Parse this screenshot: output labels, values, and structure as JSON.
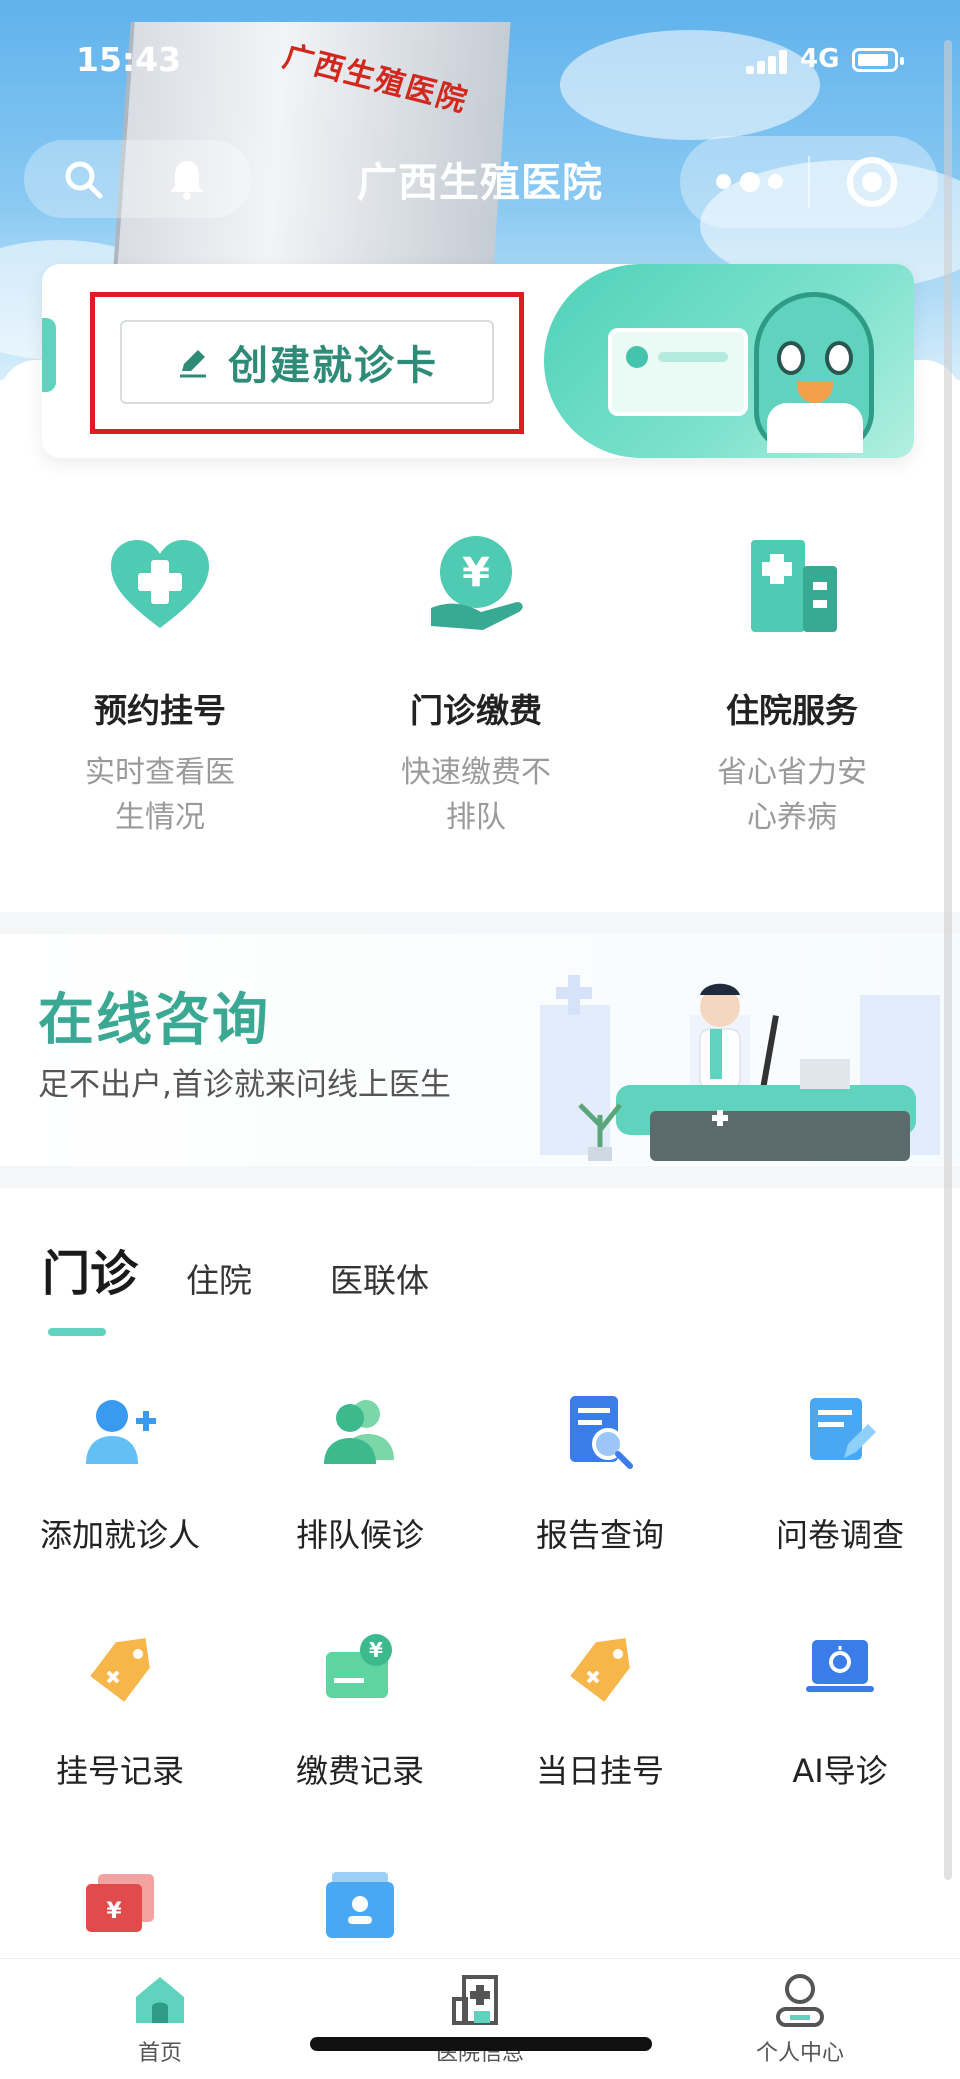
{
  "status_bar": {
    "time": "15:43",
    "network": "4G"
  },
  "nav": {
    "title": "广西生殖医院",
    "building_sign": "广西生殖医院"
  },
  "card_banner": {
    "create_label": "创建就诊卡"
  },
  "services": [
    {
      "title": "预约挂号",
      "desc": "实时查看医生情况",
      "icon": "heart-plus-icon"
    },
    {
      "title": "门诊缴费",
      "desc": "快速缴费不排队",
      "icon": "yuan-hand-icon"
    },
    {
      "title": "住院服务",
      "desc": "省心省力安心养病",
      "icon": "hospital-building-icon"
    }
  ],
  "consult": {
    "title": "在线咨询",
    "subtitle": "足不出户,首诊就来问线上医生"
  },
  "tabs": [
    {
      "label": "门诊",
      "active": true
    },
    {
      "label": "住院",
      "active": false
    },
    {
      "label": "医联体",
      "active": false
    }
  ],
  "grid": [
    {
      "label": "添加就诊人",
      "icon": "add-user-icon"
    },
    {
      "label": "排队候诊",
      "icon": "users-icon"
    },
    {
      "label": "报告查询",
      "icon": "report-search-icon"
    },
    {
      "label": "问卷调查",
      "icon": "questionnaire-icon"
    },
    {
      "label": "挂号记录",
      "icon": "tag-icon"
    },
    {
      "label": "缴费记录",
      "icon": "payment-card-icon"
    },
    {
      "label": "当日挂号",
      "icon": "tag-icon"
    },
    {
      "label": "AI导诊",
      "icon": "ai-guide-icon"
    },
    {
      "label": "",
      "icon": "yuan-card-icon"
    },
    {
      "label": "",
      "icon": "profile-folder-icon"
    }
  ],
  "tabbar": [
    {
      "label": "首页",
      "icon": "home-icon",
      "active": true
    },
    {
      "label": "医院信息",
      "icon": "hospital-icon",
      "active": false
    },
    {
      "label": "个人中心",
      "icon": "user-icon",
      "active": false
    }
  ],
  "colors": {
    "brand": "#3aa892",
    "accent": "#5fd3bd",
    "highlight_box": "#e01b23"
  }
}
